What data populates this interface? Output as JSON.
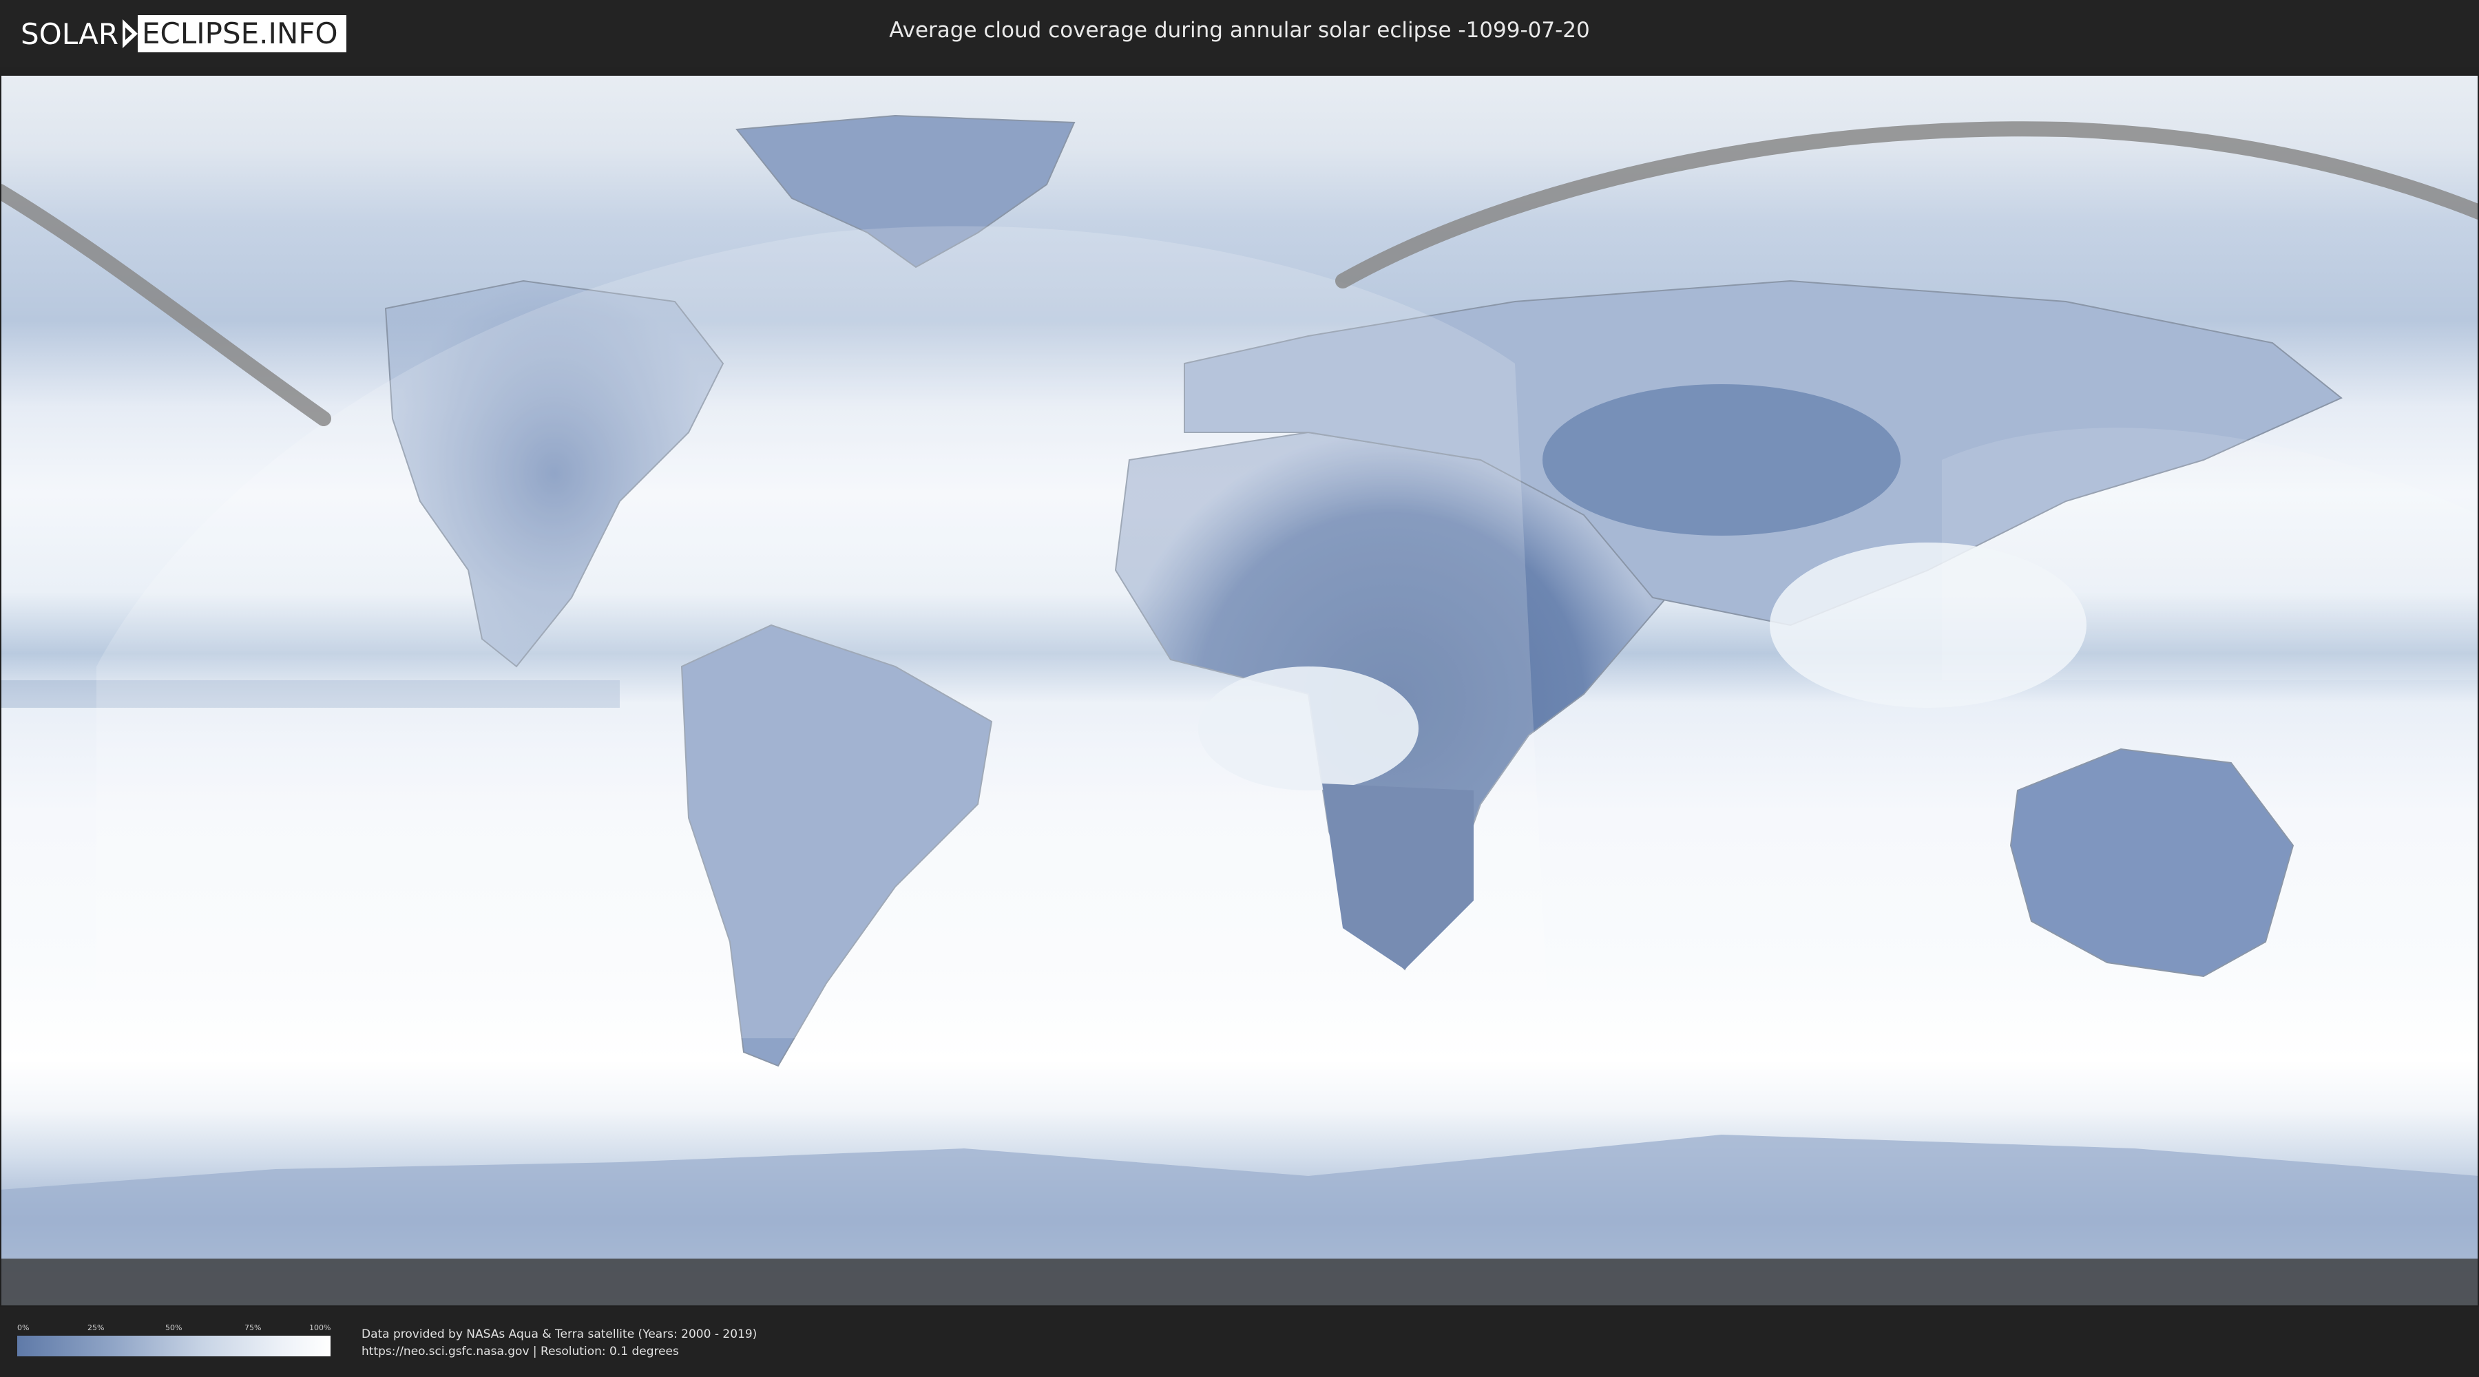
{
  "header": {
    "logo_left": "SOLAR",
    "logo_right": "ECLIPSE.INFO",
    "title": "Average cloud coverage during annular solar eclipse -1099-07-20"
  },
  "legend": {
    "ticks": [
      "0%",
      "25%",
      "50%",
      "75%",
      "100%"
    ],
    "colors": {
      "low": "#5f7aa8",
      "high": "#ffffff"
    }
  },
  "credits": {
    "line1": "Data provided by NASAs Aqua & Terra satellite (Years: 2000 - 2019)",
    "line2": "https://neo.sci.gsfc.nasa.gov | Resolution: 0.1 degrees"
  },
  "colors": {
    "header_bg": "#232323",
    "cloud_clear": "#5f7aa8",
    "cloud_full": "#ffffff",
    "eclipse_path": "#8a8a8a"
  }
}
